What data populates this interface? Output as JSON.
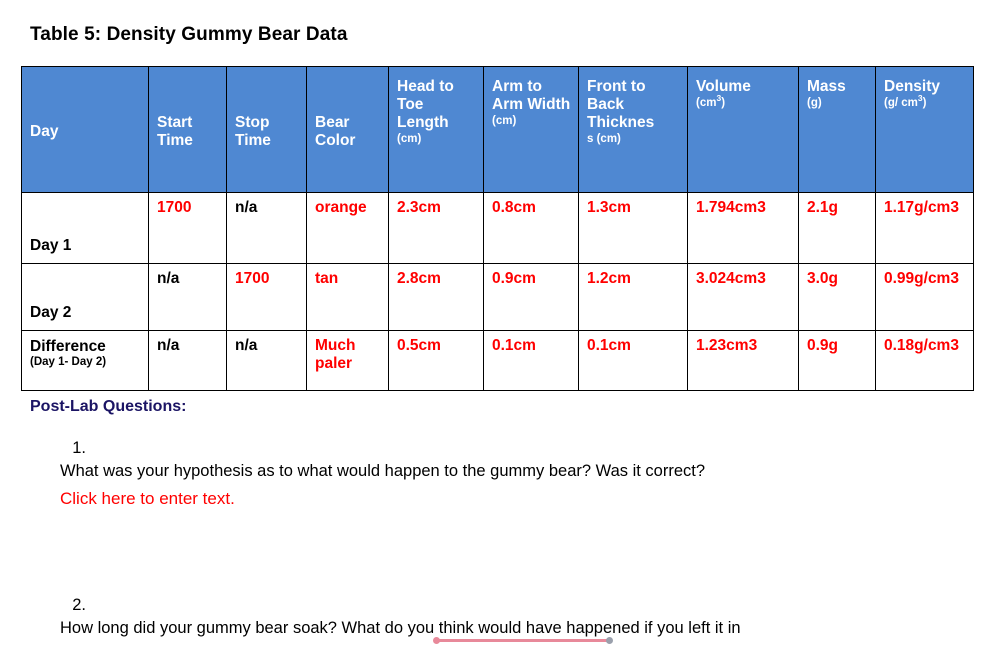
{
  "document": {
    "title": "Table 5: Density Gummy Bear Data"
  },
  "table": {
    "columns": [
      {
        "key": "day",
        "label": "Day",
        "unit": ""
      },
      {
        "key": "start",
        "label": "Start Time",
        "unit": ""
      },
      {
        "key": "stop",
        "label": "Stop Time",
        "unit": ""
      },
      {
        "key": "color",
        "label": "Bear Color",
        "unit": ""
      },
      {
        "key": "head_toe",
        "label": "Head to Toe Length",
        "unit": "(cm)"
      },
      {
        "key": "arm_arm",
        "label": "Arm to Arm Width",
        "unit": "(cm)"
      },
      {
        "key": "front_back",
        "label": "Front to Back Thickness",
        "unit": "(cm)"
      },
      {
        "key": "volume",
        "label": "Volume",
        "unit": "(cm3)"
      },
      {
        "key": "mass",
        "label": "Mass",
        "unit": "(g)"
      },
      {
        "key": "density",
        "label": "Density",
        "unit": "(g/ cm3)"
      }
    ],
    "rows": [
      {
        "label": "Day 1",
        "sub": "",
        "start": "1700",
        "stop": "n/a",
        "color": "orange",
        "head_toe": "2.3cm",
        "arm_arm": "0.8cm",
        "front_back": "1.3cm",
        "volume": "1.794cm3",
        "mass": "2.1g",
        "density": "1.17g/cm3"
      },
      {
        "label": "Day 2",
        "sub": "",
        "start": "n/a",
        "stop": "1700",
        "color": "tan",
        "head_toe": "2.8cm",
        "arm_arm": "0.9cm",
        "front_back": "1.2cm",
        "volume": "3.024cm3",
        "mass": "3.0g",
        "density": "0.99g/cm3"
      },
      {
        "label": "Difference",
        "sub": "(Day 1- Day 2)",
        "start": "n/a",
        "stop": "n/a",
        "color": "Much paler",
        "head_toe": "0.5cm",
        "arm_arm": "0.1cm",
        "front_back": "0.1cm",
        "volume": "1.23cm3",
        "mass": "0.9g",
        "density": "0.18g/cm3"
      }
    ]
  },
  "postlab": {
    "heading": "Post-Lab Questions:",
    "questions": [
      {
        "number": "1.",
        "text": "What was your hypothesis as to what would happen to the gummy bear?  Was it correct?",
        "answer": "Click here to enter text."
      },
      {
        "number": "2.",
        "text": "How long did your gummy bear soak? What do you think would have happened if you left it in",
        "answer": ""
      }
    ]
  },
  "colors": {
    "header_blue": "#4f88d2",
    "value_red": "#FF0000",
    "heading_navy": "#1B1464",
    "marker_pink": "#E8899A",
    "marker_grey": "#9aa0ac"
  }
}
